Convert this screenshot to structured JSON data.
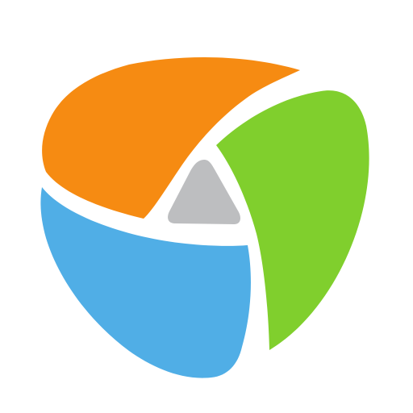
{
  "logo": {
    "name": "tri-petal-logo",
    "colors": {
      "orange": "#F68B12",
      "green": "#80CF2D",
      "blue": "#50AEE6",
      "gray": "#BDBEC0",
      "background": "#FFFFFF"
    }
  }
}
